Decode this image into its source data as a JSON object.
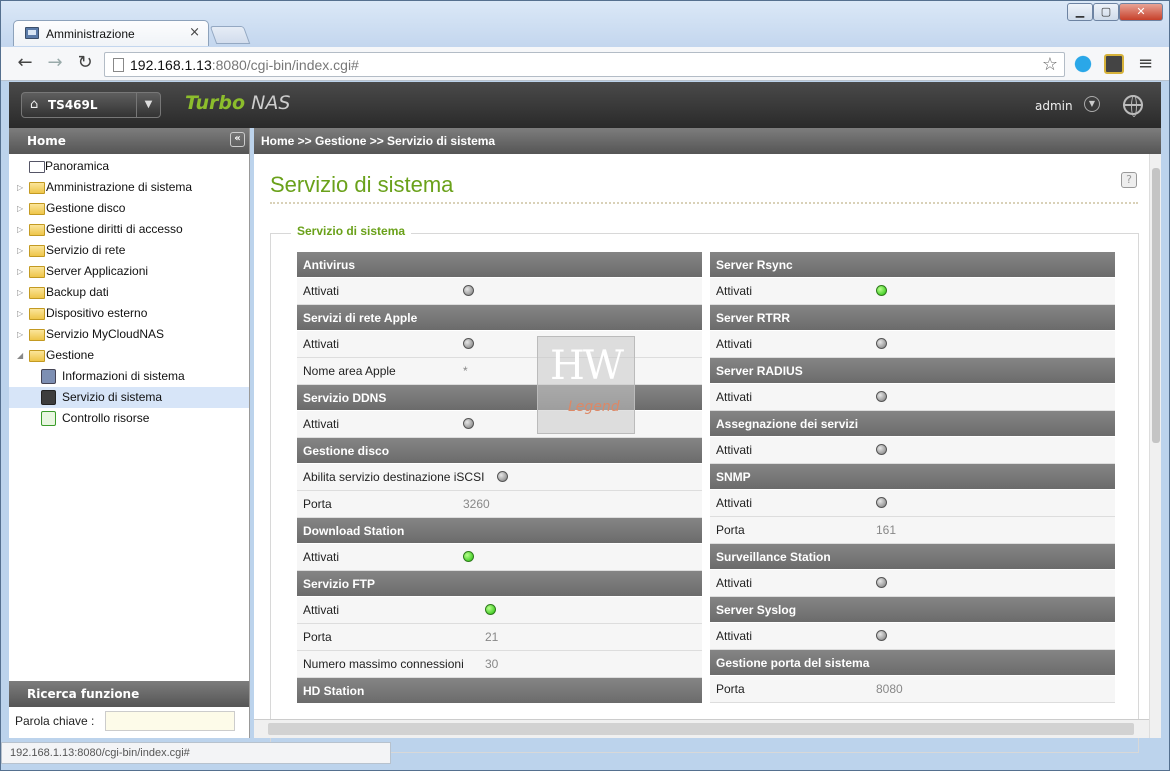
{
  "browser": {
    "tab_title": "Amministrazione",
    "tab_close": "×",
    "url_host": "192.168.1.13",
    "url_rest": ":8080/cgi-bin/index.cgi#",
    "status_url": "192.168.1.13:8080/cgi-bin/index.cgi#"
  },
  "app": {
    "model": "TS469L",
    "brand_turbo": "Turbo",
    "brand_nas": "NAS",
    "user": "admin"
  },
  "sidebar": {
    "header": "Home",
    "items": [
      {
        "label": "Panoramica"
      },
      {
        "label": "Amministrazione di sistema"
      },
      {
        "label": "Gestione disco"
      },
      {
        "label": "Gestione diritti di accesso"
      },
      {
        "label": "Servizio di rete"
      },
      {
        "label": "Server Applicazioni"
      },
      {
        "label": "Backup dati"
      },
      {
        "label": "Dispositivo esterno"
      },
      {
        "label": "Servizio MyCloudNAS"
      },
      {
        "label": "Gestione"
      }
    ],
    "subitems": [
      {
        "label": "Informazioni di sistema"
      },
      {
        "label": "Servizio di sistema"
      },
      {
        "label": "Controllo risorse"
      }
    ],
    "search_header": "Ricerca funzione",
    "search_label": "Parola chiave :"
  },
  "main": {
    "breadcrumb": "Home >> Gestione >> Servizio di sistema",
    "title": "Servizio di sistema",
    "legend": "Servizio di sistema",
    "help": "?",
    "left": [
      {
        "head": "Antivirus",
        "rows": [
          {
            "k": "Attivati",
            "led": "off"
          }
        ]
      },
      {
        "head": "Servizi di rete Apple",
        "rows": [
          {
            "k": "Attivati",
            "led": "off"
          },
          {
            "k": "Nome area Apple",
            "v": "*"
          }
        ]
      },
      {
        "head": "Servizio DDNS",
        "rows": [
          {
            "k": "Attivati",
            "led": "off"
          }
        ]
      },
      {
        "head": "Gestione disco",
        "rows": [
          {
            "k": "Abilita servizio destinazione iSCSI",
            "led": "off"
          },
          {
            "k": "Porta",
            "v": "3260"
          }
        ]
      },
      {
        "head": "Download Station",
        "rows": [
          {
            "k": "Attivati",
            "led": "on"
          }
        ]
      },
      {
        "head": "Servizio FTP",
        "rows": [
          {
            "k": "Attivati",
            "led": "on"
          },
          {
            "k": "Porta",
            "v": "21"
          },
          {
            "k": "Numero massimo connessioni",
            "v": "30"
          }
        ]
      },
      {
        "head": "HD Station",
        "rows": []
      }
    ],
    "right": [
      {
        "head": "Server Rsync",
        "rows": [
          {
            "k": "Attivati",
            "led": "on"
          }
        ]
      },
      {
        "head": "Server RTRR",
        "rows": [
          {
            "k": "Attivati",
            "led": "off"
          }
        ]
      },
      {
        "head": "Server RADIUS",
        "rows": [
          {
            "k": "Attivati",
            "led": "off"
          }
        ]
      },
      {
        "head": "Assegnazione dei servizi",
        "rows": [
          {
            "k": "Attivati",
            "led": "off"
          }
        ]
      },
      {
        "head": "SNMP",
        "rows": [
          {
            "k": "Attivati",
            "led": "off"
          },
          {
            "k": "Porta",
            "v": "161"
          }
        ]
      },
      {
        "head": "Surveillance Station",
        "rows": [
          {
            "k": "Attivati",
            "led": "off"
          }
        ]
      },
      {
        "head": "Server Syslog",
        "rows": [
          {
            "k": "Attivati",
            "led": "off"
          }
        ]
      },
      {
        "head": "Gestione porta del sistema",
        "rows": [
          {
            "k": "Porta",
            "v": "8080"
          }
        ]
      }
    ]
  },
  "watermark": {
    "top": "HW",
    "bottom": "Legend"
  }
}
